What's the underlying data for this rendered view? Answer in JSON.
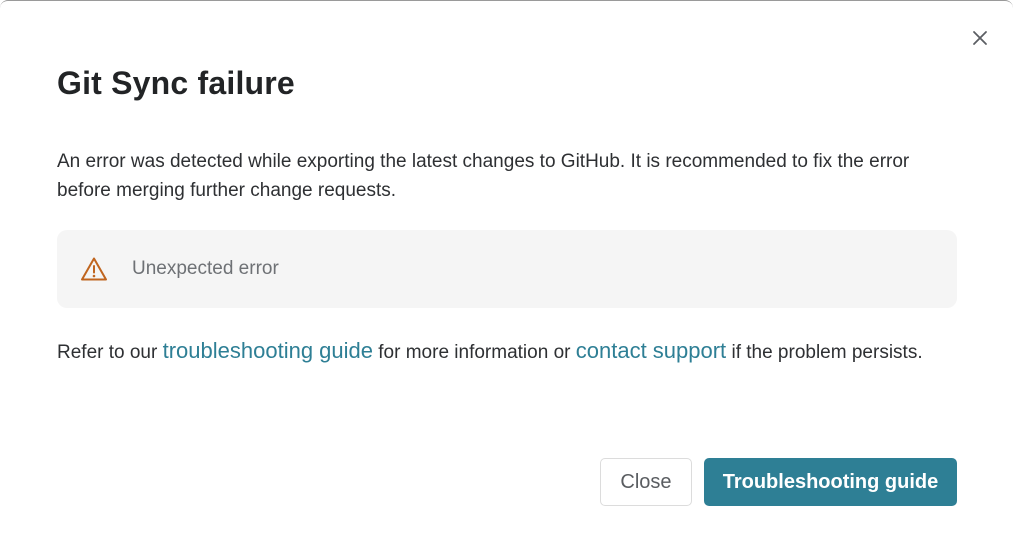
{
  "dialog": {
    "title": "Git Sync failure",
    "description": "An error was detected while exporting the latest changes to GitHub. It is recommended to fix the error before merging further change requests.",
    "error": {
      "icon": "warning-triangle-icon",
      "icon_color": "#c0651f",
      "message": "Unexpected error"
    },
    "help": {
      "prefix": "Refer to our ",
      "link1": "troubleshooting guide",
      "middle": " for more information or ",
      "link2": "contact support",
      "suffix": " if the problem persists."
    },
    "buttons": {
      "close_label": "Close",
      "primary_label": "Troubleshooting guide"
    },
    "colors": {
      "accent": "#2e7f95",
      "error_box_bg": "#f5f5f5"
    }
  }
}
